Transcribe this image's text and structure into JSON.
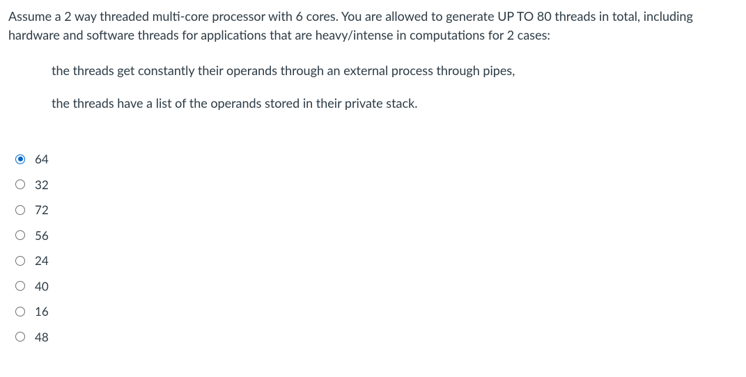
{
  "question": {
    "main_text": "Assume a 2 way threaded multi-core processor with 6 cores. You are allowed to generate UP TO 80 threads in total, including hardware and software threads for applications that are heavy/intense in computations for 2 cases:",
    "case1": "the threads get constantly their operands through an external process through pipes,",
    "case2": "the threads have a list of the operands stored in their private stack."
  },
  "options": [
    {
      "label": "64",
      "selected": true
    },
    {
      "label": "32",
      "selected": false
    },
    {
      "label": "72",
      "selected": false
    },
    {
      "label": "56",
      "selected": false
    },
    {
      "label": "24",
      "selected": false
    },
    {
      "label": "40",
      "selected": false
    },
    {
      "label": "16",
      "selected": false
    },
    {
      "label": "48",
      "selected": false
    }
  ]
}
